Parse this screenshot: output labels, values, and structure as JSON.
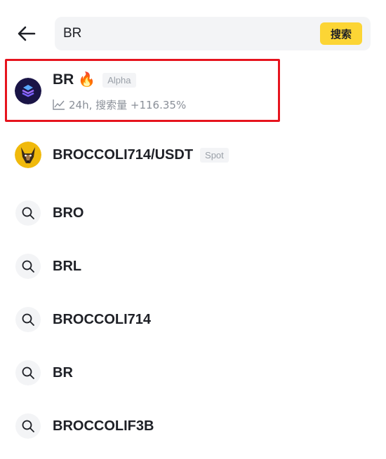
{
  "header": {
    "back_icon": "arrow-left-icon",
    "search_value": "BR",
    "search_button_label": "搜索"
  },
  "results": [
    {
      "name": "BR",
      "icon": "layers-token-icon",
      "flame": "🔥",
      "tag": "Alpha",
      "trend_icon": "trend-line-icon",
      "subtitle": "24h, 搜索量 +116.35%",
      "highlighted": true
    },
    {
      "name": "BROCCOLI714/USDT",
      "icon": "dog-token-icon",
      "tag": "Spot"
    }
  ],
  "suggestions": [
    {
      "label": "BRO",
      "icon": "search-icon"
    },
    {
      "label": "BRL",
      "icon": "search-icon"
    },
    {
      "label": "BROCCOLI714",
      "icon": "search-icon"
    },
    {
      "label": "BR",
      "icon": "search-icon"
    },
    {
      "label": "BROCCOLIF3B",
      "icon": "search-icon"
    }
  ],
  "colors": {
    "accent": "#fcd535",
    "highlight_border": "#e6141e",
    "muted_text": "#8a8f98",
    "tag_bg": "#f3f4f6"
  }
}
